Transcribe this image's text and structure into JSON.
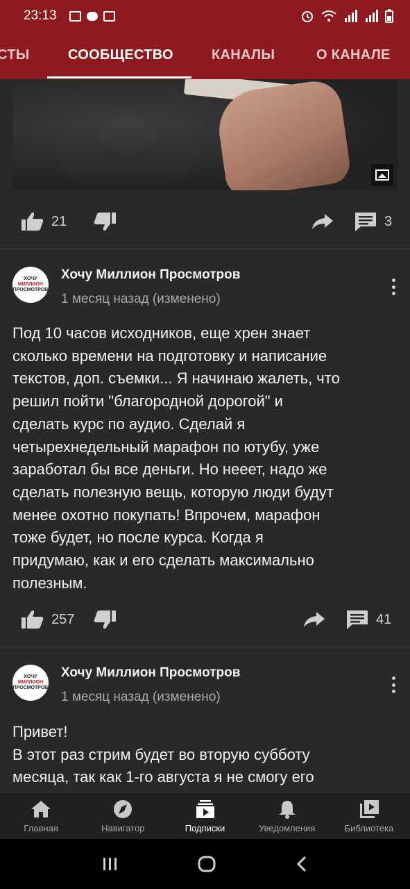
{
  "status_bar": {
    "time": "23:13"
  },
  "tabs": [
    {
      "label": "СТЫ"
    },
    {
      "label": "СООБЩЕСТВО"
    },
    {
      "label": "КАНАЛЫ"
    },
    {
      "label": "О КАНАЛЕ"
    }
  ],
  "first_post": {
    "likes": "21",
    "comments": "3"
  },
  "posts": [
    {
      "author": "Хочу Миллион Просмотров",
      "meta": "1 месяц назад (изменено)",
      "text": "Под 10 часов исходников, еще хрен знает\nсколько времени на подготовку и написание\nтекстов, доп. съемки... Я начинаю жалеть, что\nрешил пойти \"благородной дорогой\" и\nсделать курс по аудио. Сделай я\nчетырехнедельный марафон по ютубу, уже\nзаработал бы все деньги. Но нееет, надо же\nсделать полезную вещь, которую люди будут\nменее охотно покупать! Впрочем, марафон\nтоже будет, но после курса. Когда я\nпридумаю, как и его сделать максимально\nполезным.",
      "likes": "257",
      "comments": "41"
    },
    {
      "author": "Хочу Миллион Просмотров",
      "meta": "1 месяц назад (изменено)",
      "text": "Привет!\nВ этот раз стрим будет во вторую субботу\nмесяца, так как 1-го августа я не смогу его"
    }
  ],
  "avatar_logo": {
    "line1": "ХОЧУ",
    "line2": "МИЛЛИОН",
    "line3": "ПРОСМОТРОВ"
  },
  "bottom_nav": [
    {
      "label": "Главная",
      "icon": "home-icon"
    },
    {
      "label": "Навигатор",
      "icon": "compass-icon"
    },
    {
      "label": "Подписки",
      "icon": "subscriptions-icon"
    },
    {
      "label": "Уведомления",
      "icon": "bell-icon"
    },
    {
      "label": "Библиотека",
      "icon": "library-icon"
    }
  ],
  "colors": {
    "app_bar": "#8e1a20",
    "background": "#292929",
    "nav": "#212121"
  }
}
